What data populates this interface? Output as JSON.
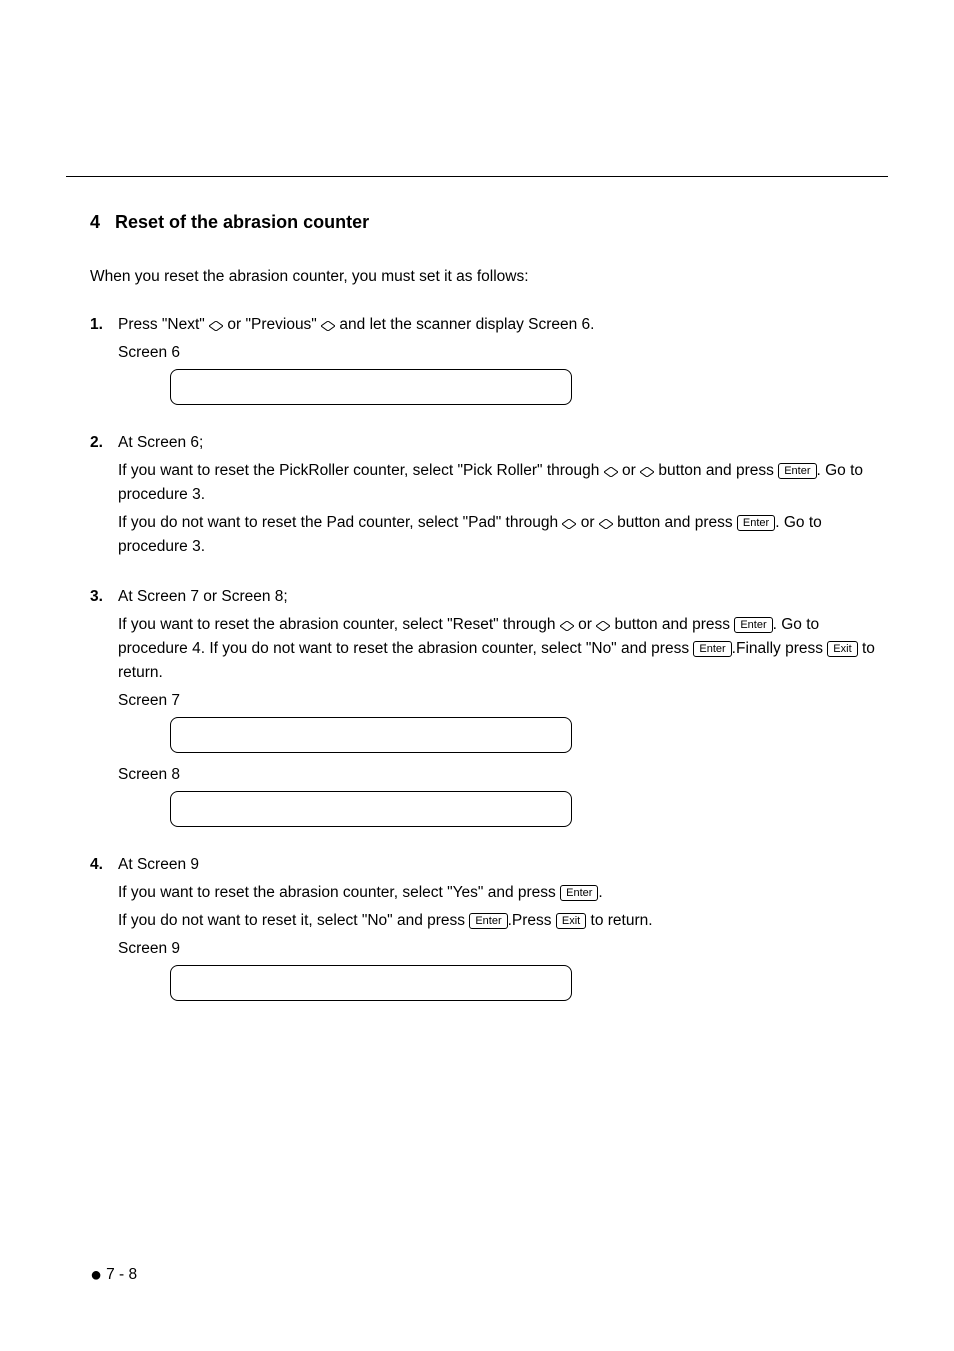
{
  "heading": {
    "number": "4",
    "title": "Reset of the abrasion counter"
  },
  "intro": "When you reset the abrasion counter, you must set it as follows:",
  "keys": {
    "enter": "Enter",
    "exit": "Exit"
  },
  "screens": {
    "s6": "Screen 6",
    "s7": "Screen 7",
    "s8": "Screen 8",
    "s9": "Screen 9"
  },
  "steps": {
    "s1": {
      "num": "1.",
      "line_a": "Press \"Next\" ",
      "line_b": " or \"Previous\" ",
      "line_c": " and let the scanner display Screen 6."
    },
    "s2": {
      "num": "2.",
      "title": "At Screen 6;",
      "p1_a": "If you want to reset the PickRoller counter, select \"Pick Roller\" through ",
      "p1_b": " or ",
      "p1_c": " button and press ",
      "p1_d": ". Go to procedure 3.",
      "p2_a": "If you do not want to reset the Pad counter, select \"Pad\" through ",
      "p2_b": " or ",
      "p2_c": " button and press ",
      "p2_d": ". Go to procedure 3."
    },
    "s3": {
      "num": "3.",
      "title": "At Screen 7 or Screen 8;",
      "p1_a": "If you want to reset the abrasion counter, select \"Reset\" through ",
      "p1_b": " or ",
      "p1_c": " button and press ",
      "p1_d": ". Go to procedure 4. If you do not want to reset the abrasion counter, select  \"No\" and press ",
      "p1_e": ".Finally press ",
      "p1_f": " to return."
    },
    "s4": {
      "num": "4.",
      "title": "At Screen 9",
      "p1_a": "If you want to reset the abrasion counter, select \"Yes\" and press ",
      "p1_b": ".",
      "p2_a": "If you do not want to reset it, select \"No\" and press ",
      "p2_b": ".Press ",
      "p2_c": " to return."
    }
  },
  "footer": "7 - 8"
}
